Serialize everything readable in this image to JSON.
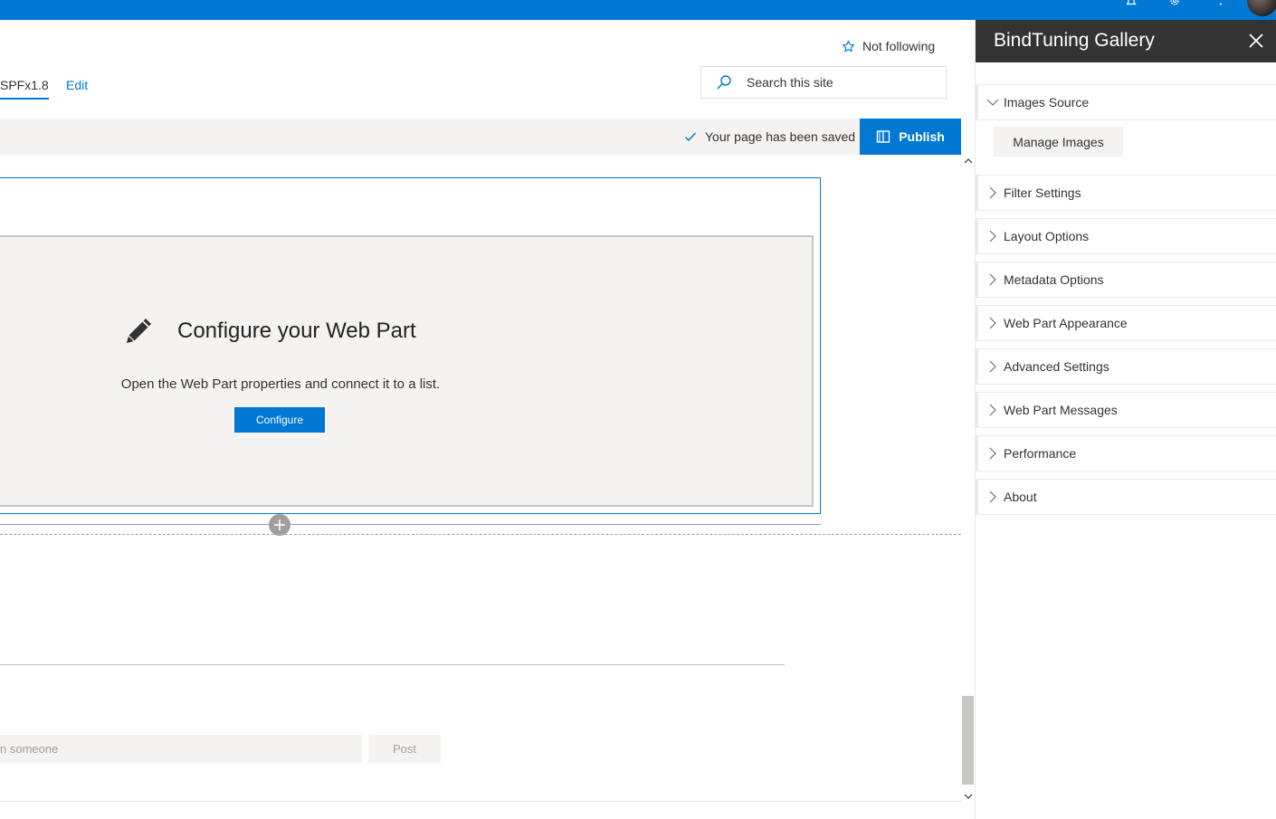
{
  "nav": {
    "current_page": "SPFx1.8",
    "edit_label": "Edit",
    "follow_label": "Not following"
  },
  "search": {
    "placeholder": "Search this site"
  },
  "commandbar": {
    "saved_status": "Your page has been saved",
    "publish_label": "Publish"
  },
  "webpart": {
    "title": "Configure your Web Part",
    "description": "Open the Web Part properties and connect it to a list.",
    "configure_label": "Configure"
  },
  "comments": {
    "input_placeholder": "n someone",
    "post_label": "Post"
  },
  "pane": {
    "title": "BindTuning Gallery",
    "manage_images_label": "Manage Images",
    "groups": [
      {
        "label": "Images Source",
        "expanded": true
      },
      {
        "label": "Filter Settings",
        "expanded": false
      },
      {
        "label": "Layout Options",
        "expanded": false
      },
      {
        "label": "Metadata Options",
        "expanded": false
      },
      {
        "label": "Web Part Appearance",
        "expanded": false
      },
      {
        "label": "Advanced Settings",
        "expanded": false
      },
      {
        "label": "Web Part Messages",
        "expanded": false
      },
      {
        "label": "Performance",
        "expanded": false
      },
      {
        "label": "About",
        "expanded": false
      }
    ]
  },
  "colors": {
    "accent": "#0078d4",
    "pane_header": "#333333",
    "neutral_bg": "#f4f3f2"
  },
  "icons": {
    "suite": [
      "bell-icon",
      "gear-icon",
      "help-icon"
    ],
    "follow": "star-icon",
    "search": "search-icon",
    "saved": "checkmark-icon",
    "publish": "book-icon",
    "webpart": "pencil-icon",
    "add": "plus-icon",
    "close": "close-icon"
  }
}
